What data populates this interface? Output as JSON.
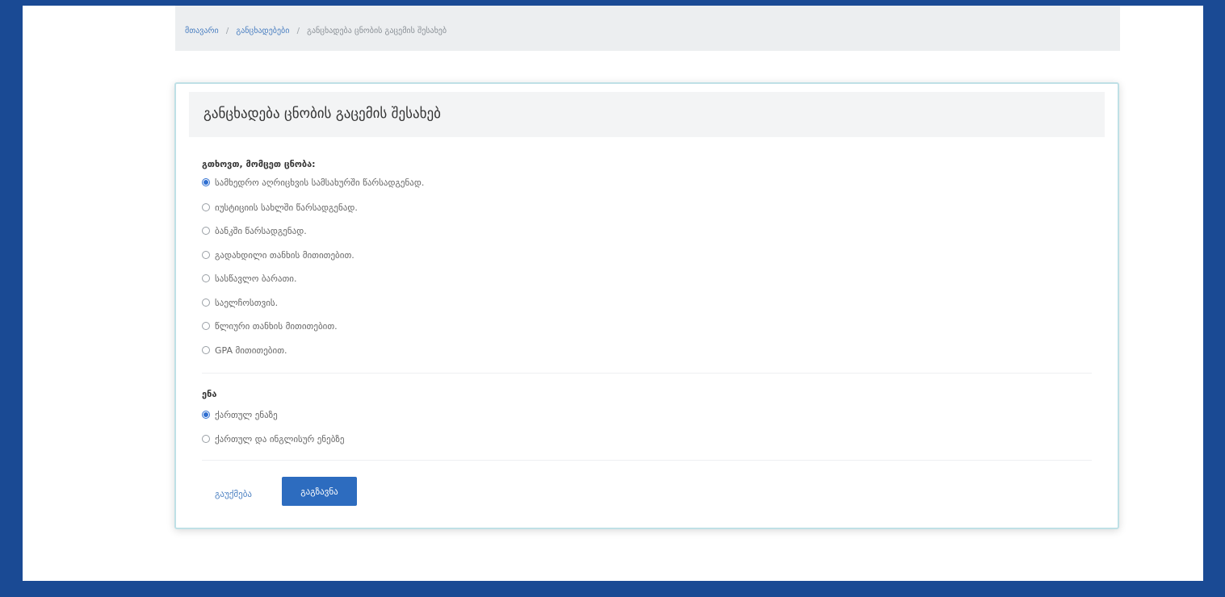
{
  "breadcrumb": {
    "home": "მთავარი",
    "applications": "განცხადებები",
    "current": "განცხადება ცნობის გაცემის შესახებ"
  },
  "form": {
    "title": "განცხადება ცნობის გაცემის შესახებ",
    "certificate_label": "გთხოვთ, მომცეთ ცნობა:",
    "certificate_options": [
      {
        "label": "სამხედრო აღრიცხვის სამსახურში წარსადგენად.",
        "checked": true
      },
      {
        "label": "იუსტიციის სახლში წარსადგენად.",
        "checked": false
      },
      {
        "label": "ბანკში წარსადგენად.",
        "checked": false
      },
      {
        "label": "გადახდილი თანხის მითითებით.",
        "checked": false
      },
      {
        "label": "სასწავლო ბარათი.",
        "checked": false
      },
      {
        "label": "საელჩოსთვის.",
        "checked": false
      },
      {
        "label": "წლიური თანხის მითითებით.",
        "checked": false
      },
      {
        "label": "GPA მითითებით.",
        "checked": false
      }
    ],
    "language_label": "ენა",
    "language_options": [
      {
        "label": "ქართულ ენაზე",
        "checked": true
      },
      {
        "label": "ქართულ და ინგლისურ ენებზე",
        "checked": false
      }
    ],
    "cancel_label": "გაუქმება",
    "submit_label": "გაგზავნა"
  },
  "colors": {
    "frame_border": "#1a4a94",
    "primary_button": "#2d6cbf",
    "link": "#4a7fc1",
    "card_border": "#bfe0e6"
  }
}
